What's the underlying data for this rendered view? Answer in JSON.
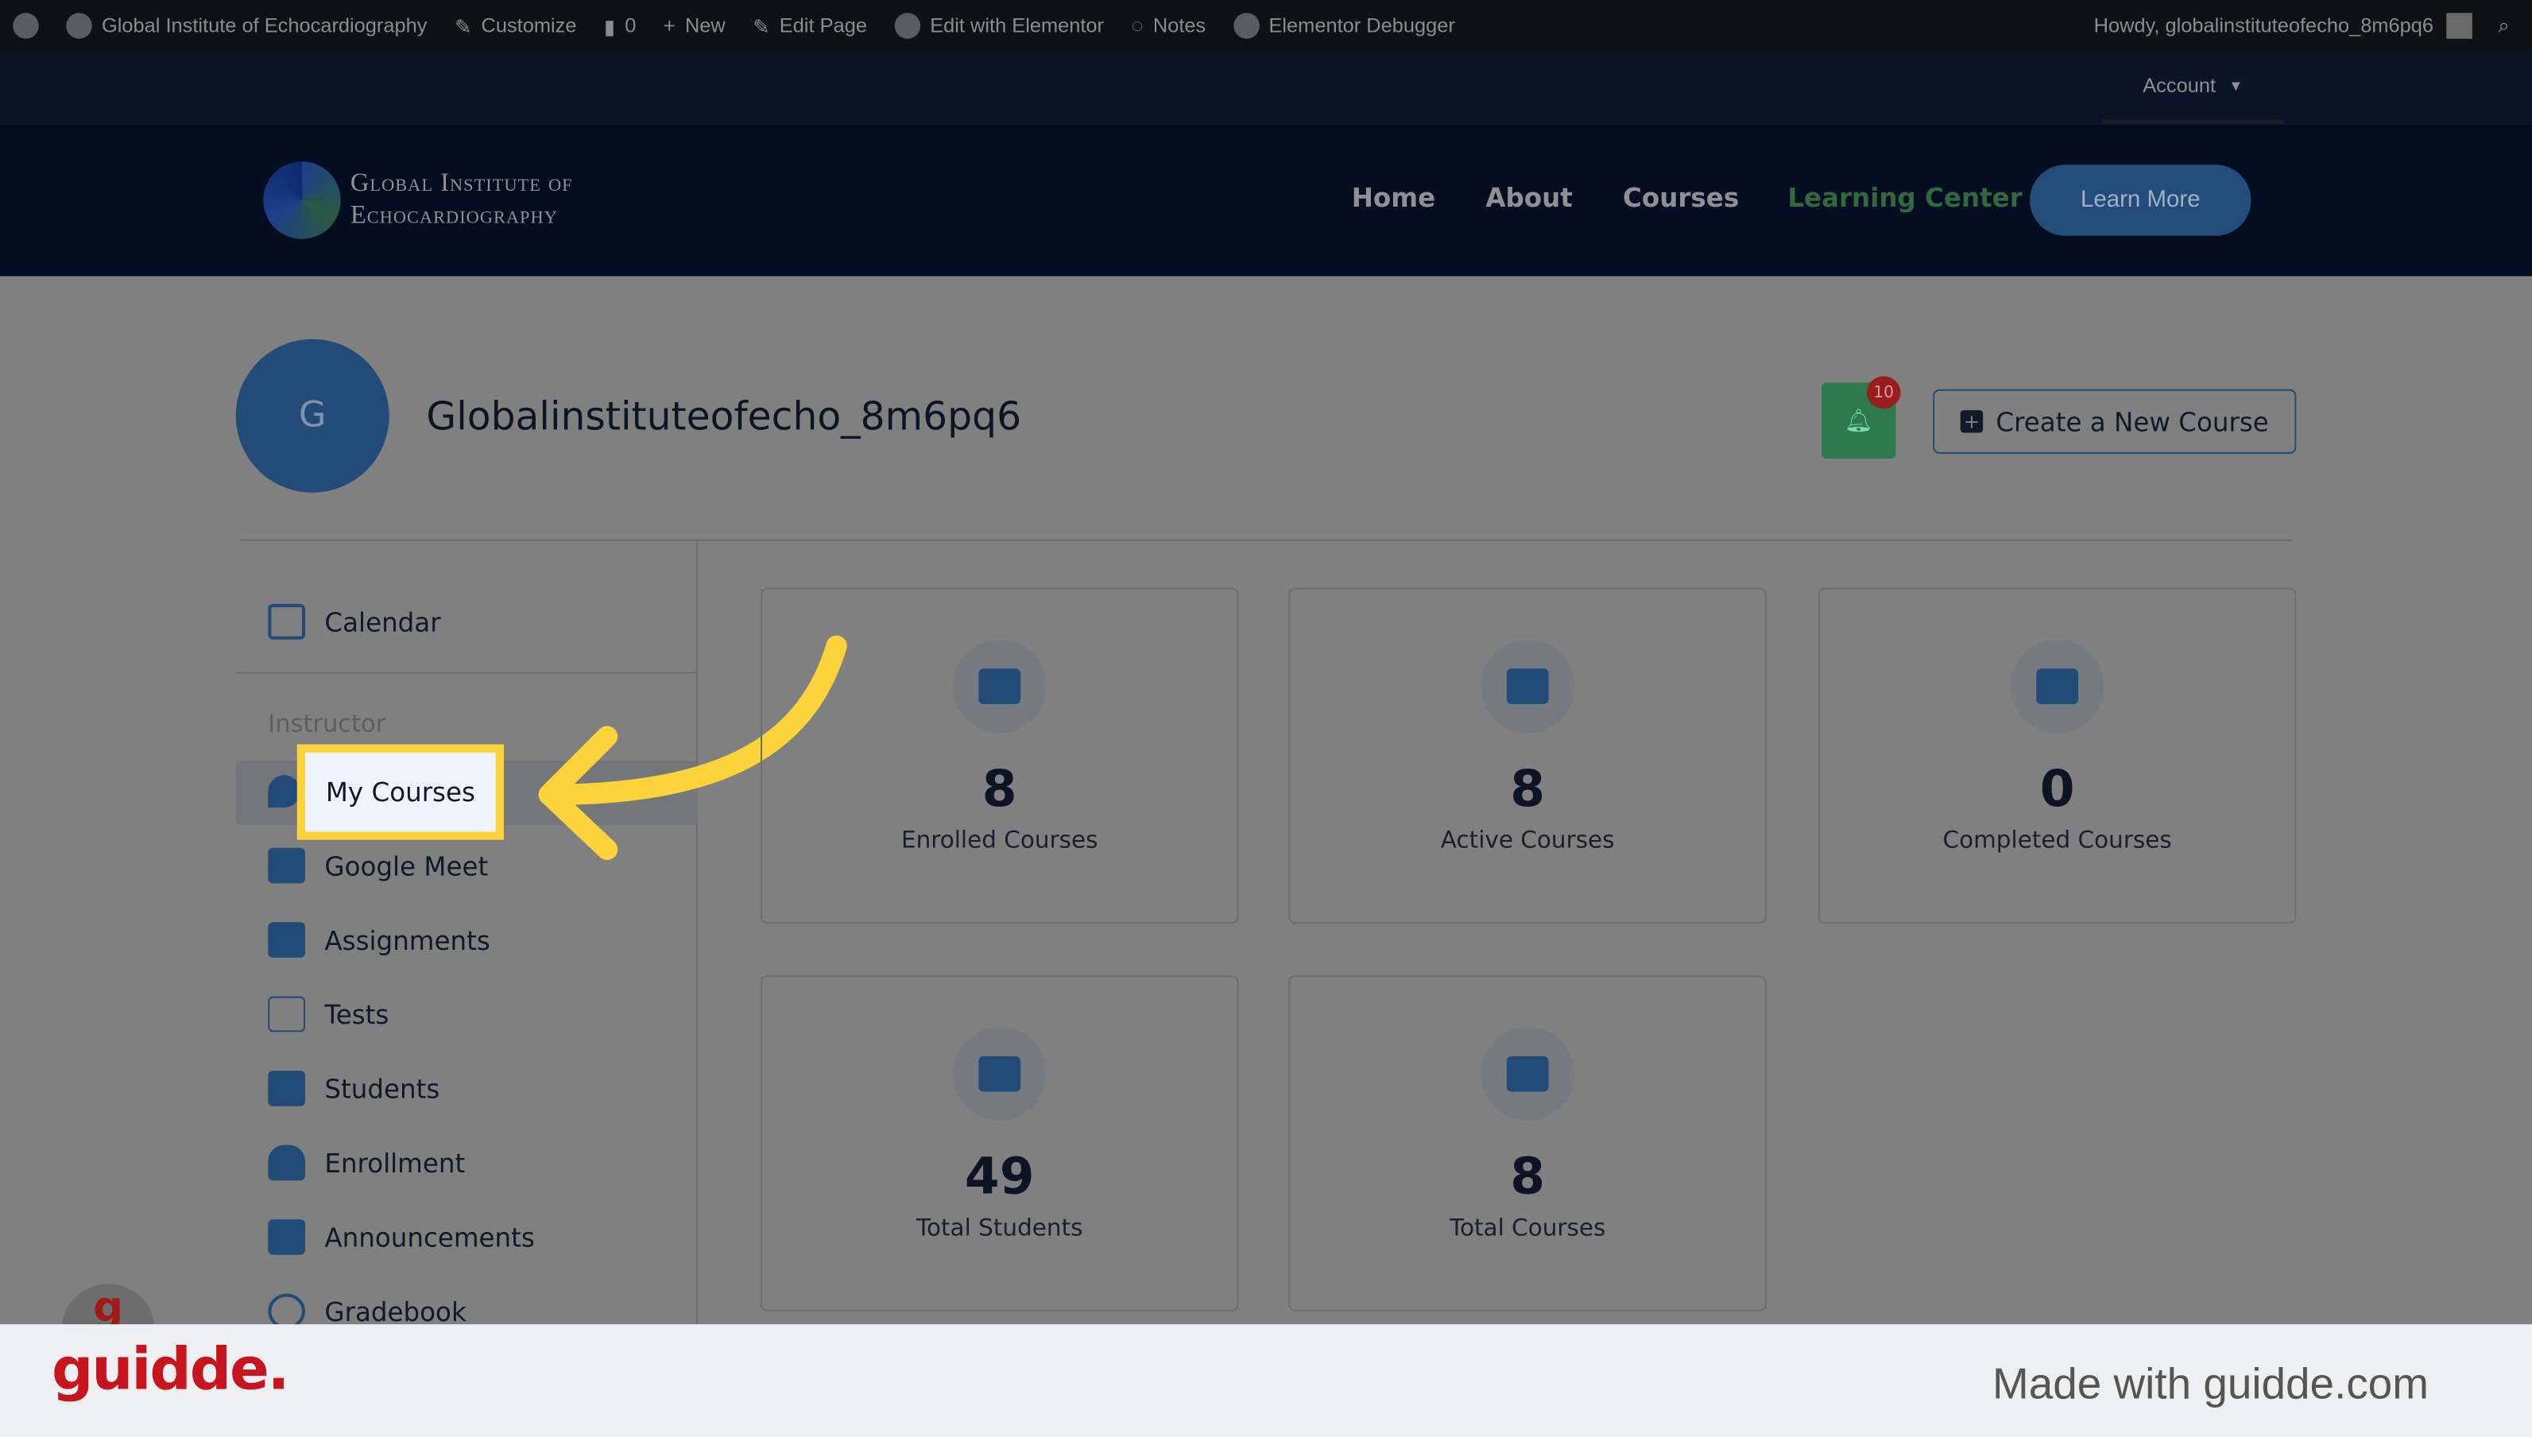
{
  "adminbar": {
    "site": "Global Institute of Echocardiography",
    "customize": "Customize",
    "comments": "0",
    "new": "New",
    "edit_page": "Edit Page",
    "edit_elementor": "Edit with Elementor",
    "notes": "Notes",
    "debugger": "Elementor Debugger",
    "howdy": "Howdy, globalinstituteofecho_8m6pq6"
  },
  "account": {
    "label": "Account"
  },
  "header": {
    "logo_line1": "Global Institute of",
    "logo_line2": "Echocardiography",
    "nav": [
      "Home",
      "About",
      "Courses",
      "Learning Center"
    ],
    "learn_more": "Learn More",
    "active_color": "#2e7a4e"
  },
  "profile": {
    "initial": "G",
    "name": "Globalinstituteofecho_8m6pq6",
    "notifications": "10",
    "create_course": "Create a New Course"
  },
  "sidebar": {
    "calendar": "Calendar",
    "section": "Instructor",
    "items": [
      "My Courses",
      "Google Meet",
      "Assignments",
      "Tests",
      "Students",
      "Enrollment",
      "Announcements",
      "Gradebook"
    ]
  },
  "stats": [
    {
      "value": "8",
      "label": "Enrolled Courses",
      "icon": "book-icon"
    },
    {
      "value": "8",
      "label": "Active Courses",
      "icon": "graduation-cap-icon"
    },
    {
      "value": "0",
      "label": "Completed Courses",
      "icon": "trophy-icon"
    },
    {
      "value": "49",
      "label": "Total Students",
      "icon": "student-icon"
    },
    {
      "value": "8",
      "label": "Total Courses",
      "icon": "box-icon"
    }
  ],
  "footer": {
    "brand": "guidde.",
    "made_with": "Made with guidde.com"
  },
  "highlight_color": "#fdd33b"
}
